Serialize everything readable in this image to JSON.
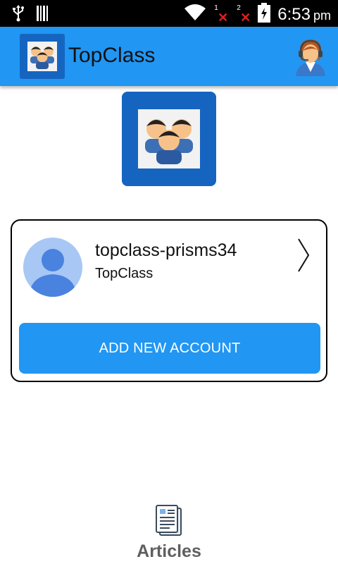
{
  "status_bar": {
    "time": "6:53",
    "ampm": "pm",
    "sim1": "1",
    "sim2": "2",
    "icons": [
      "usb-icon",
      "barcode-icon",
      "wifi-icon",
      "signal-icon",
      "signal-icon",
      "battery-charging-icon"
    ]
  },
  "app_bar": {
    "title": "TopClass",
    "logo_icon": "group-people-icon",
    "support_icon": "support-agent-icon"
  },
  "account": {
    "name": "topclass-prisms34",
    "app": "TopClass",
    "avatar_icon": "person-icon",
    "chevron_icon": "chevron-right-icon"
  },
  "add_account": {
    "label": "ADD NEW ACCOUNT"
  },
  "bottom_nav": {
    "articles_label": "Articles",
    "articles_icon": "articles-icon"
  },
  "colors": {
    "primary": "#2196f3",
    "logo_bg": "#1565c0",
    "avatar_bg": "#a8c7f5",
    "avatar_fg": "#4a82e0"
  }
}
